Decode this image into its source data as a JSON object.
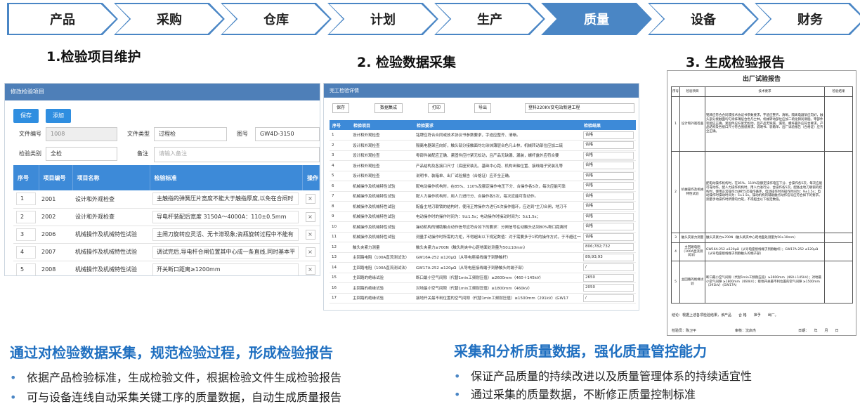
{
  "nav": [
    "产品",
    "采购",
    "仓库",
    "计划",
    "生产",
    "质量",
    "设备",
    "财务"
  ],
  "nav_active_index": 5,
  "accent": "#4a86c5",
  "sections": {
    "s1": "1.检验项目维护",
    "s2": "2. 检验数据采集",
    "s3": "3. 生成检验报告"
  },
  "p1": {
    "title": "修改检验项目",
    "save": "保存",
    "add": "添加",
    "file_no_label": "文件编号",
    "file_no": "1008",
    "file_type_label": "文件类型",
    "file_type": "过程检",
    "drawing_label": "图号",
    "drawing": "GW4D-3150",
    "category_label": "检验类别",
    "category": "全检",
    "note_label": "备注",
    "note_ph": "请输入备注",
    "headers": [
      "序号",
      "项目编号",
      "项目名称",
      "检验标准",
      "操作"
    ],
    "rows": [
      [
        "1",
        "2001",
        "设计和外观检查",
        "主触指的弹簧压片宽度不能大于触指厚度,以免在合闸时"
      ],
      [
        "2",
        "2002",
        "设计和外观检查",
        "导电杆装配后宽度 3150A～4000A：110±0.5mm"
      ],
      [
        "3",
        "2006",
        "机械操作及机械特性试验",
        "主闸刀旋转应灵活、无卡滞现象;瓷瓶旋转过程中不能有"
      ],
      [
        "4",
        "2007",
        "机械操作及机械特性试验",
        "调试完后,导电杆合闸位置其中心成一条直线,同时基本平"
      ],
      [
        "5",
        "2008",
        "机械操作及机械特性试验",
        "开关断口距离≥1200mm"
      ]
    ],
    "op": "×"
  },
  "p2": {
    "title": "完工检验详情",
    "btns": [
      "保存",
      "数据集成",
      "打印",
      "导出"
    ],
    "product": "登科220KV变电站新建工程",
    "headers": [
      "序号",
      "检验项目",
      "检验要求",
      "检验结果"
    ],
    "rows": [
      [
        "1",
        "设计和外观检查",
        "铭牌应符合合同或技术协议书参数要求，字迹应整齐、清晰。",
        "合格"
      ],
      [
        "2",
        "设计和外观检查",
        "隔离电器架应向好，触头部分接触面均匀涂抹薄层合色凡士林，机械转动部位应加二硫",
        "合格"
      ],
      [
        "3",
        "设计和外观检查",
        "零部件装配应正确、紧固件应拧紧无松动，且产品无缺漏、漏装，螺杆露外应符合要",
        "合格"
      ],
      [
        "4",
        "设计和外观检查",
        "产品结构及各接口尺寸（底座安装孔、基础中心距、机构出轴位置、接线端子安装孔等",
        "合格"
      ],
      [
        "5",
        "设计和外观检查",
        "说明书、装箱单、出厂试验报告（合格证）应齐全正确。",
        "合格"
      ],
      [
        "6",
        "机械操作及机械特性试验",
        "配电动操作机构时，在85%、110%及额定操作电压下分、合操作各5次，每次应能可靠",
        "合格"
      ],
      [
        "7",
        "机械操作及机械特性试验",
        "配人力操作机构时，用人力进行分、合操作各5次，每次应能可靠动作。",
        "合格"
      ],
      [
        "8",
        "机械操作及机械特性试验",
        "配备主地刀联锁的结构时，使用正常操作力进行5次操作循环，应达到\"主刀合闸，地刀不",
        "合格"
      ],
      [
        "9",
        "机械操作及机械特性试验",
        "电动操作时的操作时间为：9±1.5s；电动操作时操动时间为：5±1.5s；",
        "合格"
      ],
      [
        "10",
        "机械操作及机械特性试验",
        "操动机构的辅助触点动作信号应符合如下的要求：分闸信号在动触头达到80%断口距离时",
        "合格"
      ],
      [
        "11",
        "机械操作及机械特性试验",
        "测量手动操作时所需的力矩，不得超出以下规定数值：对于需要多于1转的操作方式，于不超过一转的操作方式，所需操作力不得大于250N，（允许在150度圆内不大于450",
        "合格"
      ],
      [
        "12",
        "触头夹紧力测量",
        "触头夹紧力≥700N（触头刷夹中心距地面处测量为50±10mm）",
        "806;782;732"
      ],
      [
        "13",
        "主回路电阻（100A直流测试法）",
        "GW16A-252 ≤120μΩ（从导电座接线端子到静触杆）",
        "89;93;93"
      ],
      [
        "14",
        "主回路电阻（100A直流测试法）",
        "GW17A-252 ≤120μΩ（从导电座接线端子到静触头的端子部）",
        "/"
      ],
      [
        "15",
        "主回路的绝缘试验",
        "断口最小空气间隙（代替1min工频耐压值）≥2600mm（460＋145kV）",
        "2650"
      ],
      [
        "16",
        "主回路的绝缘试验",
        "对地最小空气间隙（代替1min工频耐压值）≥1800mm（460kV）",
        "2050"
      ],
      [
        "17",
        "主回路的绝缘试验",
        "接地开关最不利位置的空气间隙（代替1min工频耐压值）≥1500mm（291kV）(GW17",
        "/"
      ]
    ]
  },
  "p3": {
    "title": "出厂试验报告",
    "headers": [
      "序号",
      "检验项目",
      "技术要求",
      "检验结果"
    ],
    "rows": [
      [
        "1",
        "设计和外观检查",
        "铭牌应符合合同或技术协议书参数要求，字迹应整齐、清晰。隔离电器架应向好，触头部分接触面均匀涂抹薄层合色凡士林，机械转动部位应加二硫化钼润滑脂。零部件装配应正确、紧固件应拧紧无松动，且产品无缺漏、漏装，螺杆露外应符合要求。产品结构及各接口尺寸符合图纸要求。说明书、装箱单、出厂试验报告（合格证）应齐全正确。",
        ""
      ],
      [
        "2",
        "机械操作及机械特性试验",
        "配电动操作机构时，在85%、110%及额定操作电压下分、合操作各5次，每次应能可靠动作。配人力操作机构时，用人力进行分、合操作各5次。配备主地刀联锁的结构时，使用正常操作力进行5次操作循环。电动操作时的操作时间为：9±1.5s；电动操作时操动时间为：5±1.5s。操动机构的辅助触点动作信号应符合如下的要求。测量手动操作时所需的力矩，不得超出以下规定数值。",
        ""
      ],
      [
        "3",
        "触头夹紧力测量",
        "触头夹紧力≥700N（触头刷夹中心距地面处测量为50±10mm）",
        ""
      ],
      [
        "4",
        "主回路电阻（100A直流测试法）",
        "GW16A-252 ≤120μΩ（从导电座接线端子到静触杆）；GW17A-252 ≤120μΩ（从导电座接线端子到静触头的端子部）",
        ""
      ],
      [
        "5",
        "主回路的绝缘试验",
        "断口最小空气间隙（代替1min工频耐压值）≥2600mm（460＋145kV）；对地最小空气间隙 ≥1800mm（460kV）；接地开关最不利位置的空气间隙 ≥1500mm（291kV）(GW17A)",
        ""
      ]
    ],
    "conclusion": "结论：根据上述各项检验结果，该产品　　合 格　　准予　　出厂。",
    "inspector": "检验员：陈卫平",
    "reviewer": "审核：沈启杰",
    "date": "日期：　　年　　月　　日"
  },
  "bottom": {
    "left_title": "通过对检验数据采集，规范检验过程，形成检验报告",
    "left_items": [
      "依据产品检验标准，生成检验文件，根据检验文件生成检验报告",
      "可与设备连线自动采集关键工序的质量数据，自动生成质量报告"
    ],
    "right_title": "采集和分析质量数据，强化质量管控能力",
    "right_items": [
      "保证产品质量的持续改进以及质量管理体系的持续适宜性",
      "通过采集的质量数据，不断修正质量控制标准"
    ],
    "bullet": "•"
  }
}
